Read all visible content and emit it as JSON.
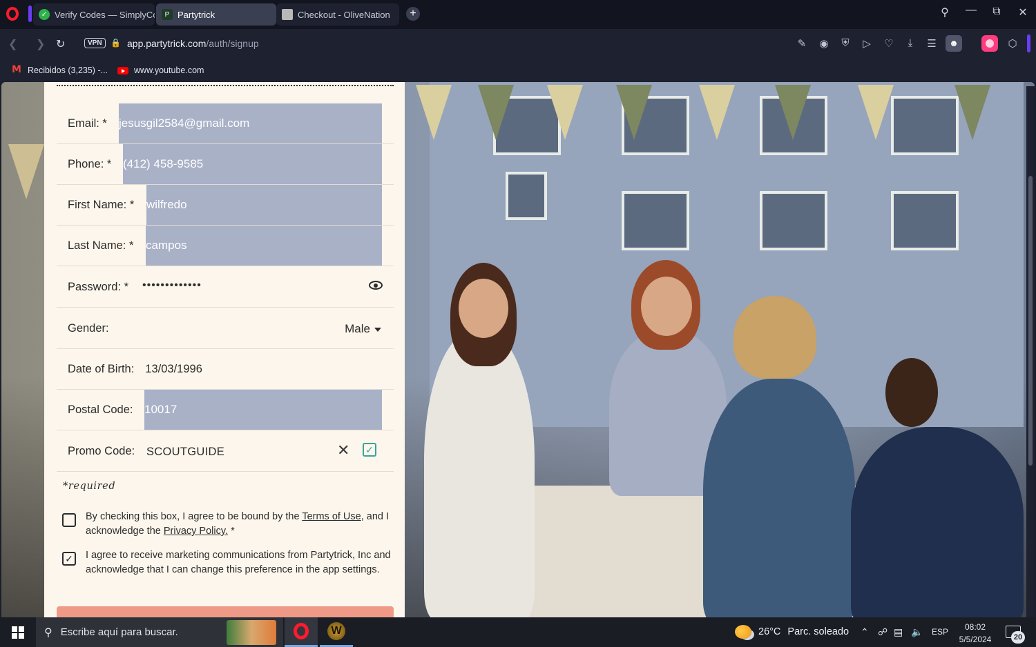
{
  "browser": {
    "tabs": [
      {
        "title": "Verify Codes — SimplyCod",
        "favicon_color": "#2db24a"
      },
      {
        "title": "Partytrick",
        "favicon_color": "#1f3b2a"
      },
      {
        "title": "Checkout - OliveNation",
        "favicon_color": "#b8b8b8"
      }
    ],
    "new_tab_symbol": "+",
    "vpn_label": "VPN",
    "url_host": "app.partytrick.com",
    "url_path": "/auth/signup",
    "bookmarks": [
      {
        "label": "Recibidos (3,235) -...",
        "icon": "gmail-icon"
      },
      {
        "label": "www.youtube.com",
        "icon": "youtube-icon"
      }
    ]
  },
  "form": {
    "fields": {
      "email": {
        "label": "Email: *",
        "value": "jesusgil2584@gmail.com"
      },
      "phone": {
        "label": "Phone: *",
        "value": "(412) 458-9585"
      },
      "first_name": {
        "label": "First Name: *",
        "value": "wilfredo"
      },
      "last_name": {
        "label": "Last Name: *",
        "value": "campos"
      },
      "password": {
        "label": "Password: *",
        "value": "•••••••••••••"
      },
      "gender": {
        "label": "Gender:",
        "value": "Male"
      },
      "dob": {
        "label": "Date of Birth:",
        "value": "13/03/1996"
      },
      "postal": {
        "label": "Postal Code:",
        "value": "10017"
      },
      "promo": {
        "label": "Promo Code:",
        "value": "SCOUTGUIDE"
      }
    },
    "required_note": "*required",
    "terms": {
      "checked": false,
      "prefix": "By checking this box, I agree to be bound by the ",
      "terms_link": "Terms of Use",
      "middle": ", and I acknowledge the ",
      "privacy_link": "Privacy Policy.",
      "suffix": " *"
    },
    "marketing": {
      "checked": true,
      "text": "I agree to receive marketing communications from Partytrick, Inc and acknowledge that I can change this preference in the app settings."
    },
    "check_mark": "✓",
    "clear_symbol": "✕",
    "fill_color": "#a9b1c7",
    "accent_color": "#3aa39b"
  },
  "taskbar": {
    "search_placeholder": "Escribe aquí para buscar.",
    "weather_temp": "26°C",
    "weather_text": "Parc. soleado",
    "language": "ESP",
    "time": "08:02",
    "date": "5/5/2024",
    "notifications": "20"
  }
}
